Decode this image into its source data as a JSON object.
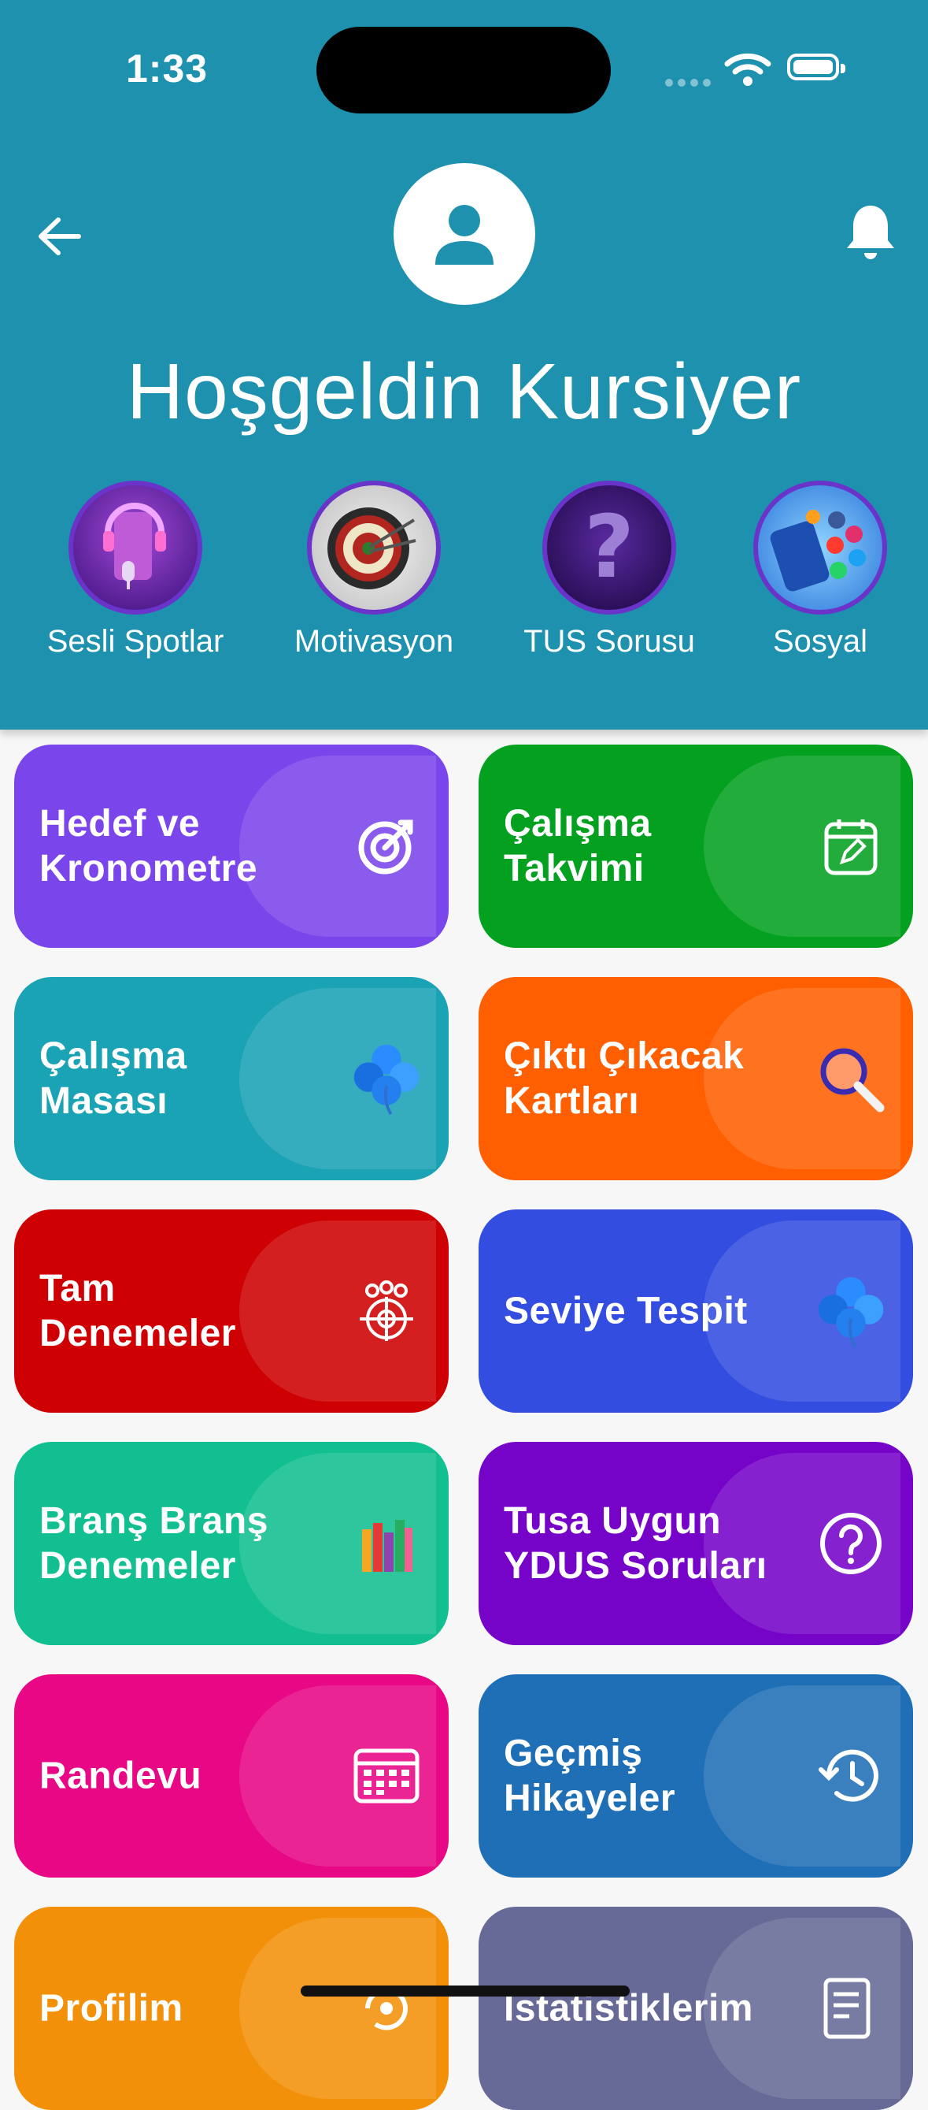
{
  "status": {
    "time": "1:33"
  },
  "header": {
    "welcome": "Hoşgeldin Kursiyer"
  },
  "stories": [
    {
      "label": "Sesli Spotlar",
      "icon": "podcast-mic-icon"
    },
    {
      "label": "Motivasyon",
      "icon": "dartboard-icon"
    },
    {
      "label": "TUS Sorusu",
      "icon": "question-mark-icon"
    },
    {
      "label": "Sosyal",
      "icon": "social-media-icon"
    }
  ],
  "cards": [
    {
      "title": "Hedef ve Kronometre",
      "color": "#7a45ea",
      "icon": "target-icon"
    },
    {
      "title": "Çalışma Takvimi",
      "color": "#04a120",
      "icon": "calendar-edit-icon"
    },
    {
      "title": "Çalışma Masası",
      "color": "#1aa2b5",
      "icon": "clover-icon"
    },
    {
      "title": "Çıktı Çıkacak Kartları",
      "color": "#ff5f00",
      "icon": "magnifier-icon"
    },
    {
      "title": "Tam Denemeler",
      "color": "#ce0003",
      "icon": "group-target-icon"
    },
    {
      "title": "Seviye Tespit",
      "color": "#324de0",
      "icon": "clover-icon"
    },
    {
      "title": "Branş Branş Denemeler",
      "color": "#12bf90",
      "icon": "books-icon"
    },
    {
      "title": "Tusa Uygun YDUS Soruları",
      "color": "#7503c8",
      "icon": "help-circle-icon"
    },
    {
      "title": "Randevu",
      "color": "#e80784",
      "icon": "calendar-grid-icon"
    },
    {
      "title": "Geçmiş Hikayeler",
      "color": "#1f6fb7",
      "icon": "history-icon"
    },
    {
      "title": "Profilim",
      "color": "#f3900a",
      "icon": "profile-refresh-icon"
    },
    {
      "title": "İstatistiklerim",
      "color": "#676a96",
      "icon": "report-icon"
    }
  ]
}
